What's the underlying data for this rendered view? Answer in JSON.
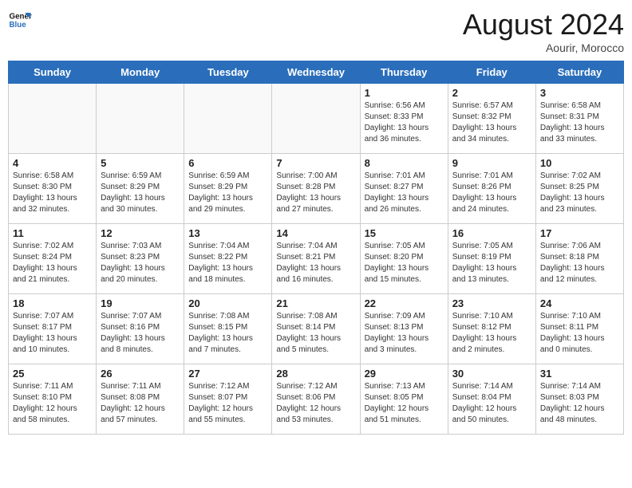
{
  "header": {
    "logo_line1": "General",
    "logo_line2": "Blue",
    "title": "August 2024",
    "subtitle": "Aourir, Morocco"
  },
  "days_of_week": [
    "Sunday",
    "Monday",
    "Tuesday",
    "Wednesday",
    "Thursday",
    "Friday",
    "Saturday"
  ],
  "weeks": [
    [
      {
        "day": "",
        "info": ""
      },
      {
        "day": "",
        "info": ""
      },
      {
        "day": "",
        "info": ""
      },
      {
        "day": "",
        "info": ""
      },
      {
        "day": "1",
        "info": "Sunrise: 6:56 AM\nSunset: 8:33 PM\nDaylight: 13 hours\nand 36 minutes."
      },
      {
        "day": "2",
        "info": "Sunrise: 6:57 AM\nSunset: 8:32 PM\nDaylight: 13 hours\nand 34 minutes."
      },
      {
        "day": "3",
        "info": "Sunrise: 6:58 AM\nSunset: 8:31 PM\nDaylight: 13 hours\nand 33 minutes."
      }
    ],
    [
      {
        "day": "4",
        "info": "Sunrise: 6:58 AM\nSunset: 8:30 PM\nDaylight: 13 hours\nand 32 minutes."
      },
      {
        "day": "5",
        "info": "Sunrise: 6:59 AM\nSunset: 8:29 PM\nDaylight: 13 hours\nand 30 minutes."
      },
      {
        "day": "6",
        "info": "Sunrise: 6:59 AM\nSunset: 8:29 PM\nDaylight: 13 hours\nand 29 minutes."
      },
      {
        "day": "7",
        "info": "Sunrise: 7:00 AM\nSunset: 8:28 PM\nDaylight: 13 hours\nand 27 minutes."
      },
      {
        "day": "8",
        "info": "Sunrise: 7:01 AM\nSunset: 8:27 PM\nDaylight: 13 hours\nand 26 minutes."
      },
      {
        "day": "9",
        "info": "Sunrise: 7:01 AM\nSunset: 8:26 PM\nDaylight: 13 hours\nand 24 minutes."
      },
      {
        "day": "10",
        "info": "Sunrise: 7:02 AM\nSunset: 8:25 PM\nDaylight: 13 hours\nand 23 minutes."
      }
    ],
    [
      {
        "day": "11",
        "info": "Sunrise: 7:02 AM\nSunset: 8:24 PM\nDaylight: 13 hours\nand 21 minutes."
      },
      {
        "day": "12",
        "info": "Sunrise: 7:03 AM\nSunset: 8:23 PM\nDaylight: 13 hours\nand 20 minutes."
      },
      {
        "day": "13",
        "info": "Sunrise: 7:04 AM\nSunset: 8:22 PM\nDaylight: 13 hours\nand 18 minutes."
      },
      {
        "day": "14",
        "info": "Sunrise: 7:04 AM\nSunset: 8:21 PM\nDaylight: 13 hours\nand 16 minutes."
      },
      {
        "day": "15",
        "info": "Sunrise: 7:05 AM\nSunset: 8:20 PM\nDaylight: 13 hours\nand 15 minutes."
      },
      {
        "day": "16",
        "info": "Sunrise: 7:05 AM\nSunset: 8:19 PM\nDaylight: 13 hours\nand 13 minutes."
      },
      {
        "day": "17",
        "info": "Sunrise: 7:06 AM\nSunset: 8:18 PM\nDaylight: 13 hours\nand 12 minutes."
      }
    ],
    [
      {
        "day": "18",
        "info": "Sunrise: 7:07 AM\nSunset: 8:17 PM\nDaylight: 13 hours\nand 10 minutes."
      },
      {
        "day": "19",
        "info": "Sunrise: 7:07 AM\nSunset: 8:16 PM\nDaylight: 13 hours\nand 8 minutes."
      },
      {
        "day": "20",
        "info": "Sunrise: 7:08 AM\nSunset: 8:15 PM\nDaylight: 13 hours\nand 7 minutes."
      },
      {
        "day": "21",
        "info": "Sunrise: 7:08 AM\nSunset: 8:14 PM\nDaylight: 13 hours\nand 5 minutes."
      },
      {
        "day": "22",
        "info": "Sunrise: 7:09 AM\nSunset: 8:13 PM\nDaylight: 13 hours\nand 3 minutes."
      },
      {
        "day": "23",
        "info": "Sunrise: 7:10 AM\nSunset: 8:12 PM\nDaylight: 13 hours\nand 2 minutes."
      },
      {
        "day": "24",
        "info": "Sunrise: 7:10 AM\nSunset: 8:11 PM\nDaylight: 13 hours\nand 0 minutes."
      }
    ],
    [
      {
        "day": "25",
        "info": "Sunrise: 7:11 AM\nSunset: 8:10 PM\nDaylight: 12 hours\nand 58 minutes."
      },
      {
        "day": "26",
        "info": "Sunrise: 7:11 AM\nSunset: 8:08 PM\nDaylight: 12 hours\nand 57 minutes."
      },
      {
        "day": "27",
        "info": "Sunrise: 7:12 AM\nSunset: 8:07 PM\nDaylight: 12 hours\nand 55 minutes."
      },
      {
        "day": "28",
        "info": "Sunrise: 7:12 AM\nSunset: 8:06 PM\nDaylight: 12 hours\nand 53 minutes."
      },
      {
        "day": "29",
        "info": "Sunrise: 7:13 AM\nSunset: 8:05 PM\nDaylight: 12 hours\nand 51 minutes."
      },
      {
        "day": "30",
        "info": "Sunrise: 7:14 AM\nSunset: 8:04 PM\nDaylight: 12 hours\nand 50 minutes."
      },
      {
        "day": "31",
        "info": "Sunrise: 7:14 AM\nSunset: 8:03 PM\nDaylight: 12 hours\nand 48 minutes."
      }
    ]
  ]
}
